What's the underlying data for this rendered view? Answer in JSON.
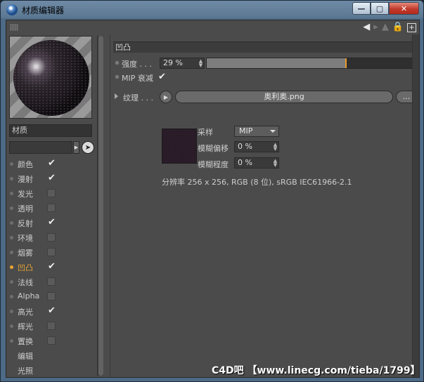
{
  "window": {
    "title": "材质编辑器",
    "buttons": {
      "minimize": "—",
      "maximize": "▢",
      "close": "✕"
    }
  },
  "toolbar": {
    "icons": [
      "back-arrow-icon",
      "forward-arrow-icon",
      "up-arrow-icon",
      "lock-icon",
      "new-window-icon"
    ]
  },
  "left": {
    "material_name_label": "材质",
    "channels": [
      {
        "label": "颜色",
        "checked": true
      },
      {
        "label": "漫射",
        "checked": true
      },
      {
        "label": "发光",
        "checked": false
      },
      {
        "label": "透明",
        "checked": false
      },
      {
        "label": "反射",
        "checked": true
      },
      {
        "label": "环境",
        "checked": false
      },
      {
        "label": "烟雾",
        "checked": false
      },
      {
        "label": "凹凸",
        "checked": true,
        "active": true
      },
      {
        "label": "法线",
        "checked": false
      },
      {
        "label": "Alpha",
        "checked": false
      },
      {
        "label": "高光",
        "checked": true
      },
      {
        "label": "辉光",
        "checked": false
      },
      {
        "label": "置换",
        "checked": false
      }
    ],
    "extras": [
      "编辑",
      "光照"
    ]
  },
  "right": {
    "section_title": "凹凸",
    "strength": {
      "label": "强度 . . .",
      "value": "29 %",
      "fraction": 0.29
    },
    "mip_falloff": {
      "label": "MIP 衰减",
      "checked": true
    },
    "texture": {
      "label": "纹理 . . .",
      "file": "奥利奥.png",
      "more": "..."
    },
    "sampling": {
      "label": "采样",
      "value": "MIP"
    },
    "blur_offset": {
      "label": "模糊偏移",
      "value": "0 %"
    },
    "blur_scale": {
      "label": "模糊程度",
      "value": "0 %"
    },
    "info": "分辨率 256 x 256, RGB (8 位), sRGB IEC61966-2.1"
  },
  "watermark": "C4D吧 【www.linecg.com/tieba/1799】",
  "colors": {
    "accent": "#e8a533",
    "panel": "#4b4b4b"
  }
}
